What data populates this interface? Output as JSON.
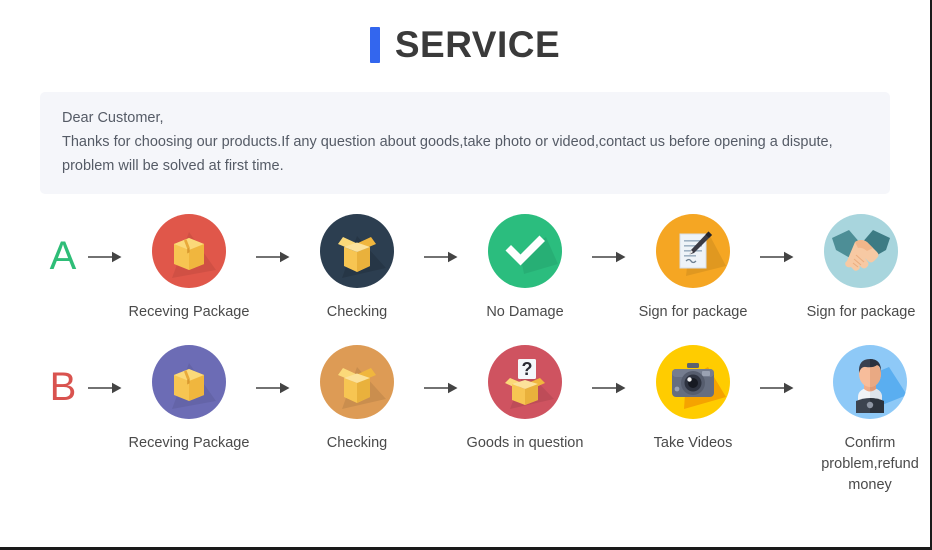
{
  "header": {
    "title": "SERVICE",
    "accent_color": "#3366ee"
  },
  "notice": {
    "line1": "Dear Customer,",
    "line2": "Thanks for choosing our products.If any question about goods,take photo or videod,contact us before opening a dispute,",
    "line3": "problem will be solved at first time.",
    "background_color": "#f5f6fa",
    "text_color": "#555b66"
  },
  "flows": [
    {
      "letter": "A",
      "letter_color": "#2ebd77",
      "steps": [
        {
          "label": "Receving Package",
          "icon": "closed-box-icon",
          "circle_color": "#e0574a"
        },
        {
          "label": "Checking",
          "icon": "open-box-icon",
          "circle_color": "#2c3e50"
        },
        {
          "label": "No Damage",
          "icon": "checkmark-icon",
          "circle_color": "#2bbd7e"
        },
        {
          "label": "Sign for package",
          "icon": "document-pen-icon",
          "circle_color": "#f5a623"
        },
        {
          "label": "Sign for package",
          "icon": "handshake-icon",
          "circle_color": "#a8d5dd"
        }
      ]
    },
    {
      "letter": "B",
      "letter_color": "#d9534f",
      "steps": [
        {
          "label": "Receving Package",
          "icon": "closed-box-icon",
          "circle_color": "#6c6cb5"
        },
        {
          "label": "Checking",
          "icon": "open-box-icon",
          "circle_color": "#dd9b55"
        },
        {
          "label": "Goods in question",
          "icon": "question-box-icon",
          "circle_color": "#cf5360"
        },
        {
          "label": "Take Videos",
          "icon": "camera-icon",
          "circle_color": "#ffcc00"
        },
        {
          "label": "Confirm problem,refund money",
          "icon": "person-icon",
          "circle_color": "#8ec9f7"
        }
      ]
    }
  ],
  "arrow": {
    "icon": "arrow-right-icon",
    "color": "#444444"
  }
}
